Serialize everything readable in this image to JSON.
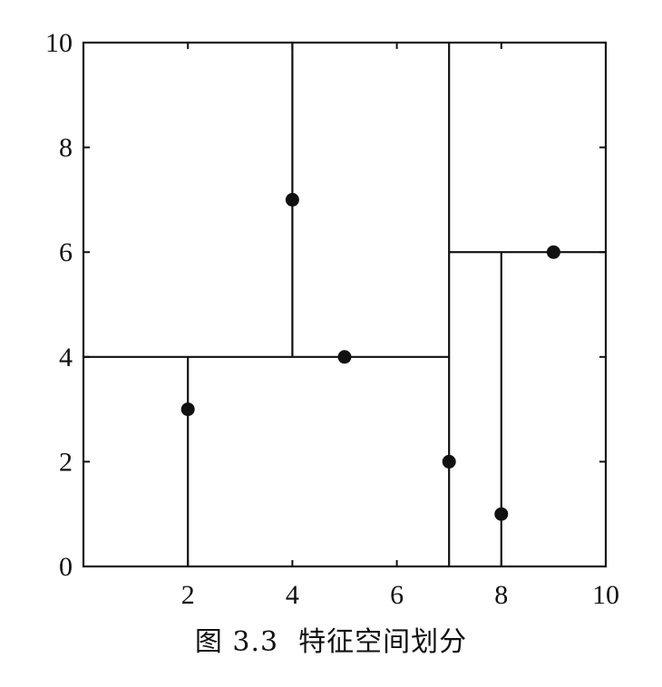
{
  "caption": {
    "figure_number": "图 3.3",
    "title": "特征空间划分"
  },
  "chart_data": {
    "type": "scatter",
    "title": "",
    "xlabel": "",
    "ylabel": "",
    "xlim": [
      0,
      10
    ],
    "ylim": [
      0,
      10
    ],
    "grid": false,
    "x_ticks": [
      2,
      4,
      6,
      8,
      10
    ],
    "y_ticks": [
      0,
      2,
      4,
      6,
      8,
      10
    ],
    "x_tick_labels": [
      "2",
      "4",
      "6",
      "8",
      "10"
    ],
    "y_tick_labels": [
      "0",
      "2",
      "4",
      "6",
      "8",
      "10"
    ],
    "points": [
      {
        "x": 2,
        "y": 3
      },
      {
        "x": 5,
        "y": 4
      },
      {
        "x": 9,
        "y": 6
      },
      {
        "x": 4,
        "y": 7
      },
      {
        "x": 8,
        "y": 1
      },
      {
        "x": 7,
        "y": 2
      }
    ],
    "partition_lines": [
      {
        "orientation": "vertical",
        "at": 7,
        "from": 0,
        "to": 10
      },
      {
        "orientation": "horizontal",
        "at": 4,
        "from": 0,
        "to": 7
      },
      {
        "orientation": "horizontal",
        "at": 6,
        "from": 7,
        "to": 10
      },
      {
        "orientation": "vertical",
        "at": 2,
        "from": 0,
        "to": 4
      },
      {
        "orientation": "vertical",
        "at": 4,
        "from": 4,
        "to": 10
      },
      {
        "orientation": "vertical",
        "at": 8,
        "from": 0,
        "to": 6
      }
    ],
    "colors": {
      "ink": "#111111",
      "background": "#ffffff"
    }
  }
}
